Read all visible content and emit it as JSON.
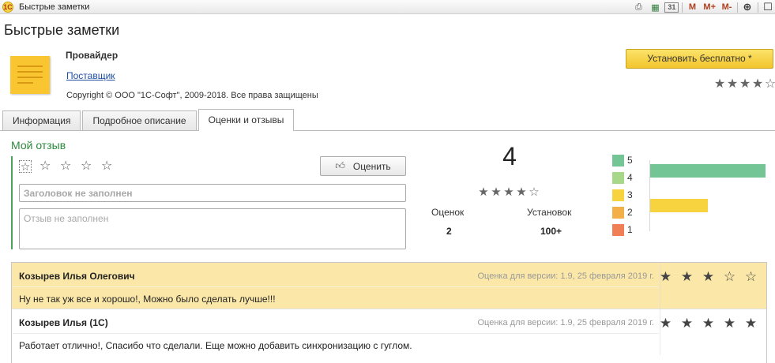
{
  "window": {
    "title": "Быстрые заметки",
    "toolbar": [
      {
        "name": "print-icon",
        "glyph": "⎙"
      },
      {
        "name": "calculator-icon",
        "glyph": "▦"
      },
      {
        "name": "calendar-icon",
        "glyph": "31"
      },
      {
        "name": "memory-m-button",
        "glyph": "M"
      },
      {
        "name": "memory-plus-button",
        "glyph": "M+"
      },
      {
        "name": "memory-minus-button",
        "glyph": "M-"
      },
      {
        "name": "zoom-icon",
        "glyph": "⊕"
      },
      {
        "name": "window-icon",
        "glyph": "☐"
      }
    ]
  },
  "header": {
    "title": "Быстрые заметки",
    "provider_title": "Провайдер",
    "vendor_link": "Поставщик",
    "copyright": "Copyright © ООО \"1С-Софт\", 2009-2018. Все права защищены",
    "install_button": "Установить бесплатно *",
    "rating_stars": [
      "★",
      "★",
      "★",
      "★",
      "☆"
    ]
  },
  "tabs": [
    {
      "label": "Информация",
      "active": false
    },
    {
      "label": "Подробное описание",
      "active": false
    },
    {
      "label": "Оценки и отзывы",
      "active": true
    }
  ],
  "my_review": {
    "title": "Мой отзыв",
    "stars": [
      "☆",
      "☆",
      "☆",
      "☆",
      "☆"
    ],
    "rate_button": "Оценить",
    "title_placeholder": "Заголовок не заполнен",
    "text_placeholder": "Отзыв не заполнен"
  },
  "summary": {
    "average": "4",
    "stars": [
      "★",
      "★",
      "★",
      "★",
      "☆"
    ],
    "ratings_label": "Оценок",
    "ratings_value": "2",
    "installs_label": "Установок",
    "installs_value": "100+"
  },
  "distribution": [
    {
      "label": "5",
      "color": "#74c596",
      "share": 1.0
    },
    {
      "label": "4",
      "color": "#a7d88a",
      "share": 0.0
    },
    {
      "label": "3",
      "color": "#f7d33f",
      "share": 0.5
    },
    {
      "label": "2",
      "color": "#f3b048",
      "share": 0.0
    },
    {
      "label": "1",
      "color": "#f07f56",
      "share": 0.0
    }
  ],
  "reviews": [
    {
      "author": "Козырев Илья Олегович",
      "version": "Оценка для версии: 1.9, 25 февраля 2019 г.",
      "text": "Ну не так уж все и хорошо!, Можно было сделать лучше!!!",
      "stars": [
        "★",
        "★",
        "★",
        "☆",
        "☆"
      ],
      "highlighted": true
    },
    {
      "author": "Козырев Илья (1С)",
      "version": "Оценка для версии: 1.9, 25 февраля 2019 г.",
      "text": "Работает отлично!, Спасибо что сделали. Еще можно добавить синхронизацию с гуглом.",
      "stars": [
        "★",
        "★",
        "★",
        "★",
        "★"
      ],
      "highlighted": false
    }
  ]
}
